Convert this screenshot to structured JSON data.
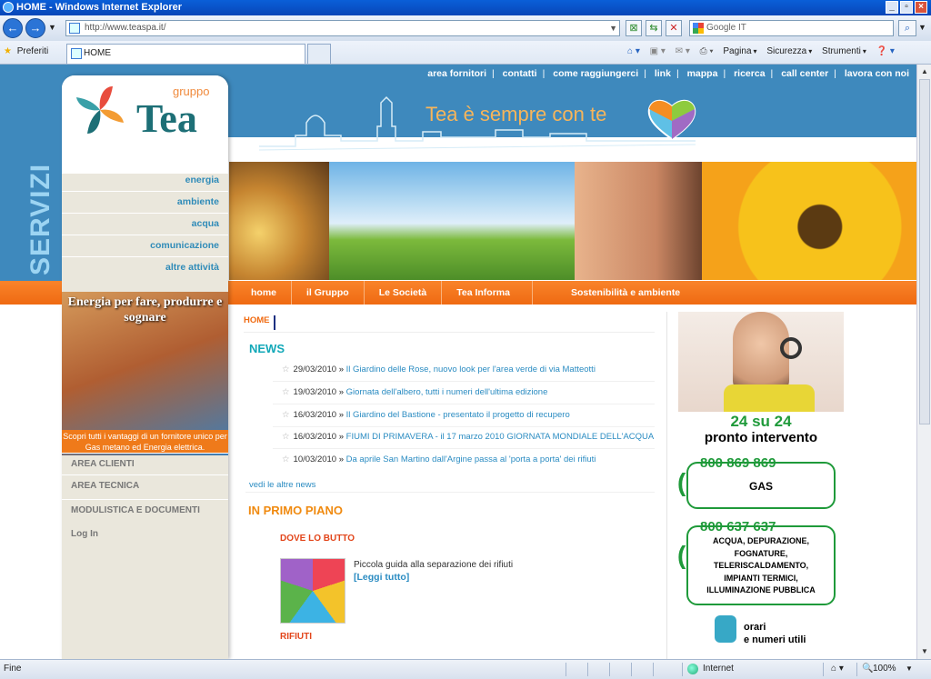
{
  "window": {
    "title": "HOME - Windows Internet Explorer"
  },
  "browser": {
    "url": "http://www.teaspa.it/",
    "search_placeholder": "Google IT",
    "favorites_label": "Preferiti",
    "tab_title": "HOME",
    "commands": [
      "Pagina",
      "Sicurezza",
      "Strumenti"
    ]
  },
  "site": {
    "top_links": [
      "area fornitori",
      "contatti",
      "come raggiungerci",
      "link",
      "mappa",
      "ricerca",
      "call center",
      "lavora con noi"
    ],
    "servizi_label": "SERVIZI",
    "logo_small": "gruppo",
    "logo_big": "Tea",
    "slogan": "Tea è sempre con te",
    "side_links": [
      "energia",
      "ambiente",
      "acqua",
      "comunicazione",
      "altre attività"
    ],
    "main_nav": [
      "home",
      "il Gruppo",
      "Le Società",
      "Tea Informa",
      "Sostenibilità e ambiente"
    ],
    "promo_title": "Energia per fare, produrre e sognare",
    "promo_caption": "Scopri tutti i vantaggi di un fornitore unico per Gas metano ed Energia elettrica.",
    "area_buttons": [
      "AREA CLIENTI",
      "AREA TECNICA",
      "MODULISTICA E DOCUMENTI",
      "Log In"
    ]
  },
  "content": {
    "breadcrumb": "HOME",
    "news_heading": "NEWS",
    "news": [
      {
        "date": "29/03/2010",
        "title": "Il Giardino delle Rose, nuovo look per l'area verde di via Matteotti"
      },
      {
        "date": "19/03/2010",
        "title": "Giornata dell'albero, tutti i numeri dell'ultima edizione"
      },
      {
        "date": "16/03/2010",
        "title": "Il Giardino del Bastione - presentato il progetto di recupero"
      },
      {
        "date": "16/03/2010",
        "title": "FIUMI DI PRIMAVERA - il 17 marzo 2010 GIORNATA MONDIALE DELL'ACQUA"
      },
      {
        "date": "10/03/2010",
        "title": "Da aprile San Martino dall'Argine passa al 'porta a porta' dei rifiuti"
      }
    ],
    "more_news": "vedi le altre news",
    "primo_piano_heading": "IN PRIMO PIANO",
    "item_title": "DOVE LO BUTTO",
    "item_desc": "Piccola guida alla separazione dei rifiuti",
    "item_link": "[Leggi tutto]",
    "item2_title": "RIFIUTI"
  },
  "emergency": {
    "h24": "24 su 24",
    "pronto": "pronto intervento",
    "gas_number": "800 869 869",
    "gas_label": "GAS",
    "acqua_number": "800 637 637",
    "acqua_lines": [
      "ACQUA, DEPURAZIONE,",
      "FOGNATURE,",
      "TELERISCALDAMENTO,",
      "IMPIANTI TERMICI,",
      "ILLUMINAZIONE PUBBLICA"
    ],
    "orari": [
      "orari",
      "e numeri utili"
    ]
  },
  "status": {
    "text": "Fine",
    "zone": "Internet",
    "zoom": "100%"
  },
  "colors": {
    "blue_band": "#3e89bd",
    "orange_nav": "#ef6a12",
    "link_blue": "#2b8cc2",
    "green_phone": "#1f9a3a"
  }
}
